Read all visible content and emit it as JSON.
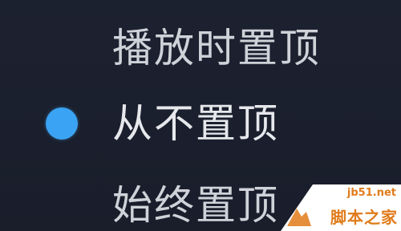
{
  "menu": {
    "items": [
      {
        "label": "播放时置顶",
        "selected": false
      },
      {
        "label": "从不置顶",
        "selected": true
      },
      {
        "label": "始终置顶",
        "selected": false
      }
    ]
  },
  "colors": {
    "background": "#1b1f2a",
    "text": "#cfd2d8",
    "radio_selected": "#3ba3f3",
    "watermark": "#e07b1a"
  },
  "watermark": {
    "url": "jb51.net",
    "name": "脚本之家"
  }
}
